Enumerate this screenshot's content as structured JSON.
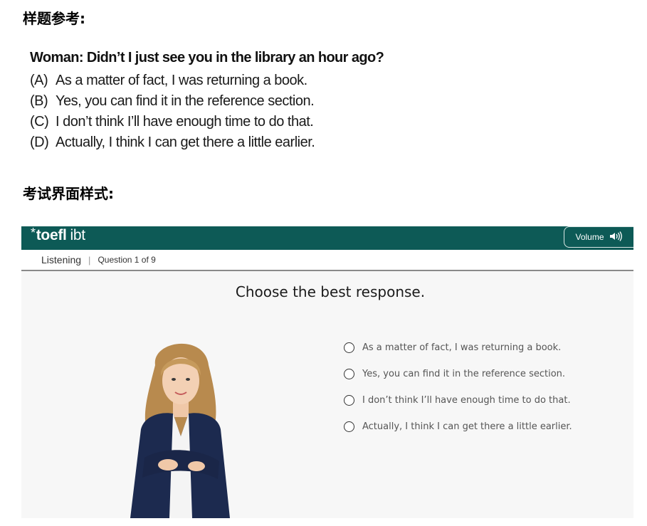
{
  "headings": {
    "sample": "样题参考:",
    "interface": "考试界面样式:"
  },
  "sample": {
    "question": "Woman: Didn’t I just see you in the library an hour ago?",
    "options": [
      {
        "letter": "(A)",
        "text": "As a matter of fact, I was returning a book."
      },
      {
        "letter": "(B)",
        "text": "Yes, you can find it in the reference section."
      },
      {
        "letter": "(C)",
        "text": "I don’t think I’ll have enough time to do that."
      },
      {
        "letter": "(D)",
        "text": "Actually, I think I can get there a little earlier."
      }
    ]
  },
  "toefl": {
    "logo_star": "*",
    "logo_toefl": "toefl",
    "logo_ibt": "ibt",
    "volume_label": "Volume",
    "volume_icon": "speaker-hand-icon",
    "section": "Listening",
    "divider": "|",
    "question_counter": "Question 1 of 9",
    "prompt": "Choose the best response.",
    "options": [
      "As a matter of fact, I was returning a book.",
      "Yes, you can find it in the reference section.",
      "I don’t think I’ll have enough time to do that.",
      "Actually, I think I can get there a little earlier."
    ],
    "colors": {
      "header": "#0d5a56",
      "background": "#f7f7f7"
    }
  }
}
